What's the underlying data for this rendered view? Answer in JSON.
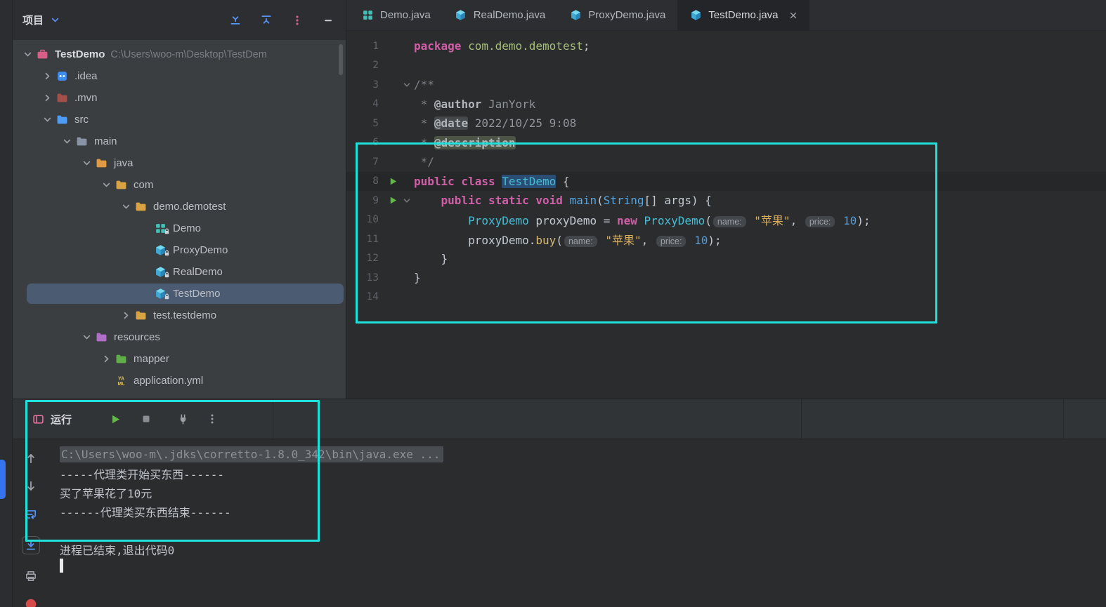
{
  "colors": {
    "annotation": "#1fe0da",
    "accent_blue": "#3574f0",
    "selection_row": "#4b5b72"
  },
  "project_panel": {
    "title": "项目",
    "items": [
      {
        "label": "TestDemo",
        "path": "C:\\Users\\woo-m\\Desktop\\TestDem",
        "indent": 0,
        "chevron": "down",
        "icon": "project",
        "bold": true
      },
      {
        "label": ".idea",
        "indent": 1,
        "chevron": "right",
        "icon": "idea-folder"
      },
      {
        "label": ".mvn",
        "indent": 1,
        "chevron": "right",
        "icon": "mvn-folder"
      },
      {
        "label": "src",
        "indent": 1,
        "chevron": "down",
        "icon": "src-folder"
      },
      {
        "label": "main",
        "indent": 2,
        "chevron": "down",
        "icon": "main-folder"
      },
      {
        "label": "java",
        "indent": 3,
        "chevron": "down",
        "icon": "java-folder"
      },
      {
        "label": "com",
        "indent": 4,
        "chevron": "down",
        "icon": "folder"
      },
      {
        "label": "demo.demotest",
        "indent": 5,
        "chevron": "down",
        "icon": "folder"
      },
      {
        "label": "Demo",
        "indent": 6,
        "chevron": "none",
        "icon": "class-grid",
        "lock": true
      },
      {
        "label": "ProxyDemo",
        "indent": 6,
        "chevron": "none",
        "icon": "class-cube",
        "lock": true
      },
      {
        "label": "RealDemo",
        "indent": 6,
        "chevron": "none",
        "icon": "class-cube",
        "lock": true
      },
      {
        "label": "TestDemo",
        "indent": 6,
        "chevron": "none",
        "icon": "class-cube",
        "lock": true,
        "selected": true
      },
      {
        "label": "test.testdemo",
        "indent": 5,
        "chevron": "right",
        "icon": "folder"
      },
      {
        "label": "resources",
        "indent": 3,
        "chevron": "down",
        "icon": "resources-folder"
      },
      {
        "label": "mapper",
        "indent": 4,
        "chevron": "right",
        "icon": "green-folder"
      },
      {
        "label": "application.yml",
        "indent": 4,
        "chevron": "none",
        "icon": "yaml-file"
      }
    ]
  },
  "tabs": [
    {
      "label": "Demo.java",
      "icon": "class-grid",
      "active": false
    },
    {
      "label": "RealDemo.java",
      "icon": "class-cube",
      "active": false
    },
    {
      "label": "ProxyDemo.java",
      "icon": "class-cube",
      "active": false
    },
    {
      "label": "TestDemo.java",
      "icon": "class-cube",
      "active": true,
      "closable": true
    }
  ],
  "editor": {
    "lines": [
      {
        "n": 1,
        "tokens": [
          {
            "t": "package",
            "c": "kw"
          },
          {
            "t": " ",
            "c": "plain"
          },
          {
            "t": "com.demo.demotest",
            "c": "pkg"
          },
          {
            "t": ";",
            "c": "plain"
          }
        ]
      },
      {
        "n": 2,
        "tokens": []
      },
      {
        "n": 3,
        "fold": true,
        "tokens": [
          {
            "t": "/**",
            "c": "cm"
          }
        ]
      },
      {
        "n": 4,
        "tokens": [
          {
            "t": " * ",
            "c": "cm"
          },
          {
            "t": "@author",
            "c": "doctag"
          },
          {
            "t": " JanYork",
            "c": "docval"
          }
        ]
      },
      {
        "n": 5,
        "tokens": [
          {
            "t": " * ",
            "c": "cm"
          },
          {
            "t": "@date",
            "c": "doctag hl"
          },
          {
            "t": " 2022/10/25 9:08",
            "c": "docval"
          }
        ]
      },
      {
        "n": 6,
        "tokens": [
          {
            "t": " * ",
            "c": "cm"
          },
          {
            "t": "@description",
            "c": "doctag hldesc"
          }
        ]
      },
      {
        "n": 7,
        "tokens": [
          {
            "t": " */",
            "c": "cm"
          }
        ]
      },
      {
        "n": 8,
        "run": true,
        "active": true,
        "tokens": [
          {
            "t": "public class ",
            "c": "kw"
          },
          {
            "t": "TestDemo",
            "c": "cls sel"
          },
          {
            "t": " {",
            "c": "plain"
          }
        ]
      },
      {
        "n": 9,
        "run": true,
        "fold": true,
        "tokens": [
          {
            "t": "    ",
            "c": "plain"
          },
          {
            "t": "public static void ",
            "c": "kw"
          },
          {
            "t": "main",
            "c": "mdecl"
          },
          {
            "t": "(",
            "c": "plain"
          },
          {
            "t": "String",
            "c": "cls2"
          },
          {
            "t": "[] args) {",
            "c": "plain"
          }
        ]
      },
      {
        "n": 10,
        "tokens": [
          {
            "t": "        ",
            "c": "plain"
          },
          {
            "t": "ProxyDemo",
            "c": "cls"
          },
          {
            "t": " proxyDemo = ",
            "c": "plain"
          },
          {
            "t": "new",
            "c": "kw"
          },
          {
            "t": " ",
            "c": "plain"
          },
          {
            "t": "ProxyDemo",
            "c": "cls"
          },
          {
            "t": "(",
            "c": "plain"
          },
          {
            "t": "name:",
            "c": "inlay"
          },
          {
            "t": " ",
            "c": "plain"
          },
          {
            "t": "\"苹果\"",
            "c": "str"
          },
          {
            "t": ", ",
            "c": "plain"
          },
          {
            "t": "price:",
            "c": "inlay"
          },
          {
            "t": " ",
            "c": "plain"
          },
          {
            "t": "10",
            "c": "num"
          },
          {
            "t": ");",
            "c": "plain"
          }
        ]
      },
      {
        "n": 11,
        "tokens": [
          {
            "t": "        proxyDemo.",
            "c": "plain"
          },
          {
            "t": "buy",
            "c": "mcall"
          },
          {
            "t": "(",
            "c": "plain"
          },
          {
            "t": "name:",
            "c": "inlay"
          },
          {
            "t": " ",
            "c": "plain"
          },
          {
            "t": "\"苹果\"",
            "c": "str"
          },
          {
            "t": ", ",
            "c": "plain"
          },
          {
            "t": "price:",
            "c": "inlay"
          },
          {
            "t": " ",
            "c": "plain"
          },
          {
            "t": "10",
            "c": "num"
          },
          {
            "t": ");",
            "c": "plain"
          }
        ]
      },
      {
        "n": 12,
        "tokens": [
          {
            "t": "    }",
            "c": "plain"
          }
        ]
      },
      {
        "n": 13,
        "tokens": [
          {
            "t": "}",
            "c": "plain"
          }
        ]
      },
      {
        "n": 14,
        "tokens": []
      }
    ]
  },
  "run_panel": {
    "tab_label": "运行",
    "console_lines": [
      {
        "style": "cmd",
        "text": "C:\\Users\\woo-m\\.jdks\\corretto-1.8.0_342\\bin\\java.exe ..."
      },
      {
        "style": "out",
        "text": "-----代理类开始买东西------"
      },
      {
        "style": "out",
        "text": "买了苹果花了10元"
      },
      {
        "style": "out",
        "text": "------代理类买东西结束------"
      },
      {
        "style": "blank",
        "text": ""
      },
      {
        "style": "out",
        "text": "进程已结束,退出代码0"
      },
      {
        "style": "caret",
        "text": ""
      }
    ]
  }
}
